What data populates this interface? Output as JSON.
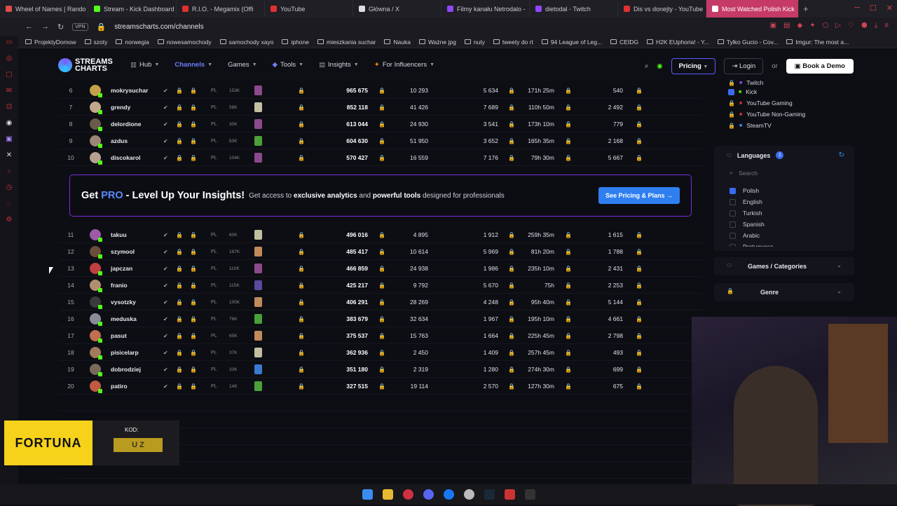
{
  "browser": {
    "tabs": [
      {
        "title": "Wheel of Names | Rando",
        "color": "#e04c4c"
      },
      {
        "title": "Stream - Kick Dashboard",
        "color": "#53fc18"
      },
      {
        "title": "R.I.O. - Megamix (Offi",
        "color": "#e03030"
      },
      {
        "title": "YouTube",
        "color": "#e03030"
      },
      {
        "title": "Główna / X",
        "color": "#dddddd"
      },
      {
        "title": "Filmy kanału Netrodalo -",
        "color": "#9146ff"
      },
      {
        "title": "dietodal - Twitch",
        "color": "#9146ff"
      },
      {
        "title": "Dis vs donejty - YouTube",
        "color": "#e03030"
      },
      {
        "title": "Most Watched Polish Kick",
        "color": "#ffffff"
      }
    ],
    "vpn_label": "VPN",
    "url": "streamscharts.com/channels",
    "bookmarks": [
      "ProjektyDomow",
      "szoty",
      "norwegia",
      "nowesamochody",
      "samochody xayo",
      "iphone",
      "mieszkania suchar",
      "Nauka",
      "Ważne jpg",
      "nuty",
      "tweety do rt",
      "94 League of Leg...",
      "CEIDG",
      "H2K EUphoria! - Y...",
      "Tylko Gucio - Cov...",
      "Imgur: The most a..."
    ]
  },
  "site": {
    "logo_line1": "STREAMS",
    "logo_line2": "CHARTS",
    "nav": [
      "Hub",
      "Channels",
      "Games",
      "Tools",
      "Insights",
      "For Influencers"
    ],
    "pricing": "Pricing",
    "login": "Login",
    "or": "or",
    "demo": "Book a Demo"
  },
  "rows_top": [
    {
      "rank": "6",
      "name": "mokrysuchar",
      "lang": "PL",
      "followers": "153K",
      "hours": "965 675",
      "peak": "10 293",
      "avg": "5 634",
      "airtime": "171h 25m",
      "fol_gain": "540",
      "color": "#c5a04a",
      "game": "#8b4a8b"
    },
    {
      "rank": "7",
      "name": "grendy",
      "lang": "PL",
      "followers": "58K",
      "hours": "852 118",
      "peak": "41 426",
      "avg": "7 689",
      "airtime": "110h 50m",
      "fol_gain": "2 492",
      "color": "#c2a98d",
      "game": "#c2c0a0"
    },
    {
      "rank": "8",
      "name": "delordione",
      "lang": "PL",
      "followers": "30K",
      "hours": "613 044",
      "peak": "24 930",
      "avg": "3 541",
      "airtime": "173h 10m",
      "fol_gain": "779",
      "color": "#6a5a4a",
      "game": "#8b4a8b"
    },
    {
      "rank": "9",
      "name": "azdus",
      "lang": "PL",
      "followers": "63K",
      "hours": "604 630",
      "peak": "51 950",
      "avg": "3 652",
      "airtime": "165h 35m",
      "fol_gain": "2 168",
      "color": "#9b8574",
      "game": "#4aa03a"
    },
    {
      "rank": "10",
      "name": "discokarol",
      "lang": "PL",
      "followers": "104K",
      "hours": "570 427",
      "peak": "16 559",
      "avg": "7 176",
      "airtime": "79h 30m",
      "fol_gain": "5 667",
      "color": "#b8a090",
      "game": "#8b4a8b"
    }
  ],
  "promo": {
    "title_pre": "Get ",
    "title_pro": "PRO",
    "title_post": " - Level Up Your Insights!",
    "desc1": "Get access to ",
    "desc_b1": "exclusive analytics",
    "desc2": " and ",
    "desc_b2": "powerful tools",
    "desc3": " designed for professionals",
    "cta": "See Pricing & Plans  →"
  },
  "rows_bottom": [
    {
      "rank": "11",
      "name": "takuu",
      "lang": "PL",
      "followers": "60K",
      "hours": "496 016",
      "peak": "4 895",
      "avg": "1 912",
      "airtime": "259h 35m",
      "fol_gain": "1 615",
      "color": "#9a5aa5",
      "game": "#c2c0a0"
    },
    {
      "rank": "12",
      "name": "szymool",
      "lang": "PL",
      "followers": "187K",
      "hours": "485 417",
      "peak": "10 614",
      "avg": "5 969",
      "airtime": "81h 20m",
      "fol_gain": "1 788",
      "color": "#6b4d3a",
      "game": "#c08a5a"
    },
    {
      "rank": "13",
      "name": "japczan",
      "lang": "PL",
      "followers": "110K",
      "hours": "466 859",
      "peak": "24 938",
      "avg": "1 986",
      "airtime": "235h 10m",
      "fol_gain": "2 431",
      "color": "#c04040",
      "game": "#8b4a8b"
    },
    {
      "rank": "14",
      "name": "franio",
      "lang": "PL",
      "followers": "115K",
      "hours": "425 217",
      "peak": "9 792",
      "avg": "5 670",
      "airtime": "75h",
      "fol_gain": "2 253",
      "color": "#b09070",
      "game": "#5a4aa0"
    },
    {
      "rank": "15",
      "name": "vysotzky",
      "lang": "PL",
      "followers": "100K",
      "hours": "406 291",
      "peak": "28 269",
      "avg": "4 248",
      "airtime": "95h 40m",
      "fol_gain": "5 144",
      "color": "#3a3a3a",
      "game": "#c08a5a"
    },
    {
      "rank": "16",
      "name": "meduska",
      "lang": "PL",
      "followers": "76K",
      "hours": "383 679",
      "peak": "32 634",
      "avg": "1 967",
      "airtime": "195h 10m",
      "fol_gain": "4 661",
      "color": "#8a8a9a",
      "game": "#4aa03a"
    },
    {
      "rank": "17",
      "name": "pasut",
      "lang": "PL",
      "followers": "65K",
      "hours": "375 537",
      "peak": "15 763",
      "avg": "1 664",
      "airtime": "225h 45m",
      "fol_gain": "2 798",
      "color": "#c07050",
      "game": "#c08a5a"
    },
    {
      "rank": "18",
      "name": "pisicelarp",
      "lang": "PL",
      "followers": "37K",
      "hours": "362 936",
      "peak": "2 450",
      "avg": "1 409",
      "airtime": "257h 45m",
      "fol_gain": "493",
      "color": "#a07a5a",
      "game": "#c2c0a0"
    },
    {
      "rank": "19",
      "name": "dobrodziej",
      "lang": "PL",
      "followers": "33K",
      "hours": "351 180",
      "peak": "2 319",
      "avg": "1 280",
      "airtime": "274h 30m",
      "fol_gain": "699",
      "color": "#7a6a5a",
      "game": "#3a7ad0"
    },
    {
      "rank": "20",
      "name": "patiro",
      "lang": "PL",
      "followers": "14K",
      "hours": "327 515",
      "peak": "19 114",
      "avg": "2 570",
      "airtime": "127h 30m",
      "fol_gain": "675",
      "color": "#c05a40",
      "game": "#4aa03a"
    }
  ],
  "sidebar": {
    "platforms": [
      {
        "label": "Twitch",
        "checked": false
      },
      {
        "label": "Kick",
        "checked": true
      },
      {
        "label": "YouTube Gaming",
        "checked": false
      },
      {
        "label": "YouTube Non-Gaming",
        "checked": false
      },
      {
        "label": "SteamTV",
        "checked": false
      }
    ],
    "languages_title": "Languages",
    "languages_count": "1",
    "search_placeholder": "Search",
    "languages": [
      {
        "label": "Polish",
        "checked": true
      },
      {
        "label": "English",
        "checked": false
      },
      {
        "label": "Turkish",
        "checked": false
      },
      {
        "label": "Spanish",
        "checked": false
      },
      {
        "label": "Arabic",
        "checked": false
      },
      {
        "label": "Portuguese",
        "checked": false
      }
    ],
    "games_title": "Games / Categories",
    "genre_title": "Genre"
  },
  "overlay": {
    "fortuna": "FORTUNA",
    "kod": "KOD:",
    "code": "U Z"
  }
}
